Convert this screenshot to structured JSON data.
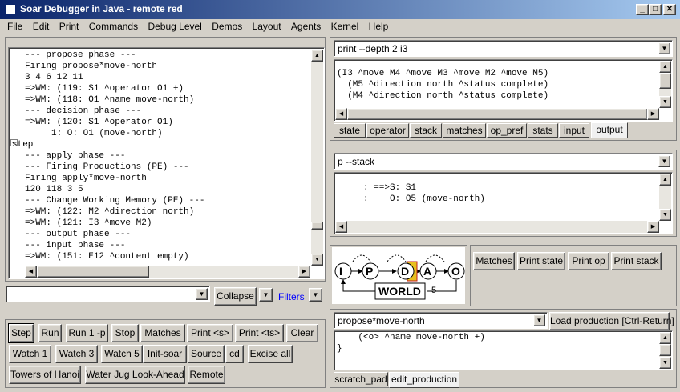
{
  "window": {
    "title": "Soar Debugger in Java - remote red",
    "minimize": "_",
    "maximize": "□",
    "close": "✕"
  },
  "menu": [
    "File",
    "Edit",
    "Print",
    "Commands",
    "Debug Level",
    "Demos",
    "Layout",
    "Agents",
    "Kernel",
    "Help"
  ],
  "trace": {
    "lines": [
      "--- propose phase ---",
      "Firing propose*move-north",
      "3 4 6 12 11",
      "=>WM: (119: S1 ^operator O1 +)",
      "=>WM: (118: O1 ^name move-north)",
      "--- decision phase ---",
      "=>WM: (120: S1 ^operator O1)",
      "     1: O: O1 (move-north)",
      "step",
      "--- apply phase ---",
      "--- Firing Productions (PE) ---",
      "Firing apply*move-north",
      "120 118 3 5",
      "--- Change Working Memory (PE) ---",
      "=>WM: (122: M2 ^direction north)",
      "=>WM: (121: I3 ^move M2)",
      "--- output phase ---",
      "--- input phase ---",
      "=>WM: (151: E12 ^content empty)"
    ],
    "collapse_icon": "−"
  },
  "command_bar": {
    "input_value": "",
    "collapse_label": "Collapse",
    "filters_label": "Filters"
  },
  "buttons_row1": [
    "Step",
    "Run",
    "Run 1 -p",
    "Stop",
    "Matches",
    "Print <s>",
    "Print <ts>",
    "Clear"
  ],
  "buttons_row2": [
    "Watch 1",
    "Watch 3",
    "Watch 5",
    "Init-soar",
    "Source",
    "cd",
    "Excise all"
  ],
  "buttons_row3": [
    "Towers of Hanoi",
    "Water Jug Look-Ahead",
    "Remote"
  ],
  "print_pane": {
    "command": "print --depth 2 i3",
    "lines": [
      "(I3 ^move M4 ^move M3 ^move M2 ^move M5)",
      "  (M5 ^direction north ^status complete)",
      "  (M4 ^direction north ^status complete)"
    ],
    "tabs": [
      "state",
      "operator",
      "stack",
      "matches",
      "op_pref",
      "stats",
      "input",
      "output"
    ],
    "active_tab": "output"
  },
  "stack_pane": {
    "command": "p --stack",
    "lines": [
      "     : ==>S: S1",
      "     :    O: O5 (move-north)"
    ]
  },
  "diagram": {
    "nodes": [
      "I",
      "P",
      "D",
      "A",
      "O"
    ],
    "world_label": "WORLD",
    "cycle_count": "5"
  },
  "action_buttons": [
    "Matches",
    "Print state",
    "Print op",
    "Print stack"
  ],
  "edit_pane": {
    "production": "propose*move-north",
    "load_label": "Load production [Ctrl-Return]",
    "lines": [
      "    (<o> ^name move-north +)",
      "}"
    ],
    "tabs": [
      "scratch_pad",
      "edit_production"
    ],
    "active_tab": "edit_production"
  },
  "colors": {
    "title_start": "#0a246a",
    "title_end": "#a6caf0",
    "face": "#d4d0c8",
    "filters_link": "#0000ff"
  }
}
